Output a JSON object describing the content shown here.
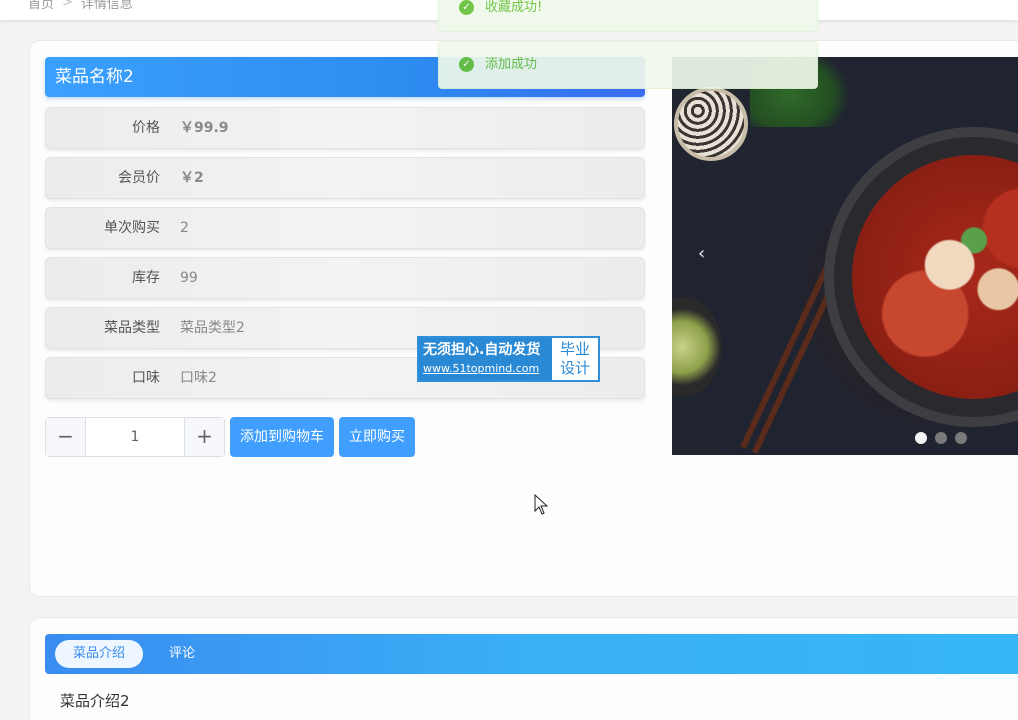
{
  "breadcrumb": {
    "home": "首页",
    "sep": ">",
    "current": "详情信息"
  },
  "product": {
    "name": "菜品名称2",
    "rows": [
      {
        "label": "价格",
        "value": "￥99.9",
        "bold": true
      },
      {
        "label": "会员价",
        "value": "￥2",
        "bold": true
      },
      {
        "label": "单次购买",
        "value": "2",
        "bold": false
      },
      {
        "label": "库存",
        "value": "99",
        "bold": false
      },
      {
        "label": "菜品类型",
        "value": "菜品类型2",
        "bold": false
      },
      {
        "label": "口味",
        "value": "口味2",
        "bold": false
      }
    ]
  },
  "stepper": {
    "minus": "−",
    "value": "1",
    "plus": "+"
  },
  "actions": {
    "add_to_cart": "添加到购物车",
    "buy_now": "立即购买"
  },
  "carousel": {
    "prev": "‹",
    "active_index": 0,
    "count": 3
  },
  "watermark": {
    "line1": "无须担心.自动发货",
    "line2": "www.51topmind.com",
    "right1": "毕业",
    "right2": "设计"
  },
  "toasts": [
    {
      "text": "收藏成功!"
    },
    {
      "text": "添加成功"
    }
  ],
  "tabs": [
    {
      "label": "菜品介绍",
      "active": true
    },
    {
      "label": "评论",
      "active": false
    }
  ],
  "description": "菜品介绍2",
  "colors": {
    "primary": "#409eff",
    "success": "#67c23a"
  }
}
